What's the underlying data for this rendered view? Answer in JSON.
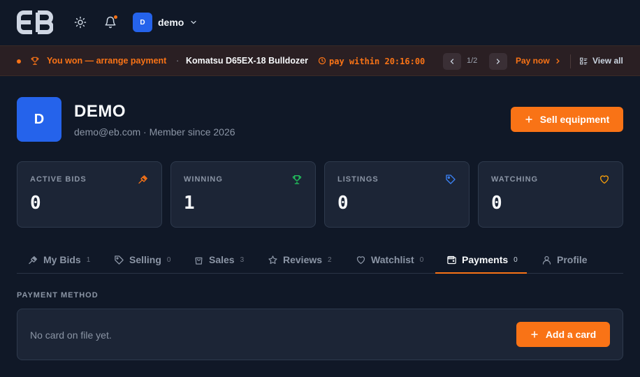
{
  "nav": {
    "logo_text": "EB",
    "theme_icon": "sun-icon",
    "notification_icon": "bell-icon",
    "user": {
      "avatar_letter": "D",
      "name": "demo"
    }
  },
  "banner": {
    "message": "You won — arrange payment",
    "separator": "·",
    "item": "Komatsu D65EX-18 Bulldozer",
    "timer_text": "pay within 20:16:00",
    "pager": "1/2",
    "pay_now": "Pay now",
    "view_all": "View all"
  },
  "profile": {
    "avatar_letter": "D",
    "name": "DEMO",
    "meta": "demo@eb.com · Member since 2026",
    "sell_button": "Sell equipment"
  },
  "stats": [
    {
      "label": "ACTIVE BIDS",
      "value": "0",
      "icon": "gavel-icon",
      "color": "#f97316"
    },
    {
      "label": "WINNING",
      "value": "1",
      "icon": "trophy-icon",
      "color": "#22c55e"
    },
    {
      "label": "LISTINGS",
      "value": "0",
      "icon": "tag-icon",
      "color": "#3b82f6"
    },
    {
      "label": "WATCHING",
      "value": "0",
      "icon": "heart-icon",
      "color": "#f59e0b"
    }
  ],
  "tabs": [
    {
      "label": "My Bids",
      "count": "1",
      "icon": "gavel-icon"
    },
    {
      "label": "Selling",
      "count": "0",
      "icon": "tag-icon"
    },
    {
      "label": "Sales",
      "count": "3",
      "icon": "shopping-bag-icon"
    },
    {
      "label": "Reviews",
      "count": "2",
      "icon": "star-icon"
    },
    {
      "label": "Watchlist",
      "count": "0",
      "icon": "heart-icon"
    },
    {
      "label": "Payments",
      "count": "0",
      "icon": "wallet-icon",
      "active": true
    },
    {
      "label": "Profile",
      "count": "",
      "icon": "user-icon"
    }
  ],
  "payment": {
    "section_title": "PAYMENT METHOD",
    "empty_text": "No card on file yet.",
    "add_button": "Add a card"
  },
  "colors": {
    "accent": "#f97316",
    "background": "#101827",
    "card": "#1c2536"
  }
}
